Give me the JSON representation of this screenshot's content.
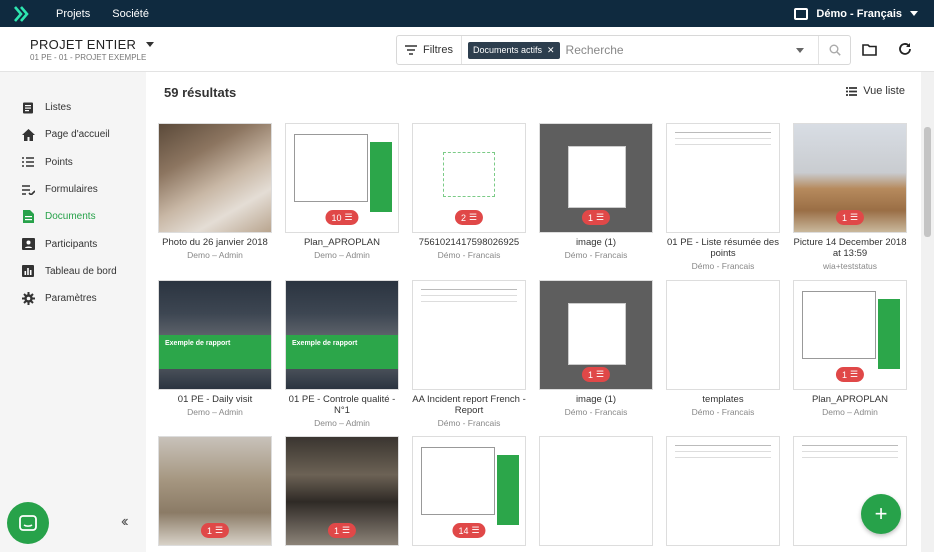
{
  "topbar": {
    "nav": [
      "Projets",
      "Société"
    ],
    "user": "Démo - Français"
  },
  "project": {
    "title": "PROJET ENTIER",
    "subtitle": "01 PE - 01 - PROJET EXEMPLE"
  },
  "filter": {
    "label": "Filtres",
    "chip": "Documents actifs",
    "search_placeholder": "Recherche"
  },
  "sidebar": {
    "items": [
      {
        "label": "Listes",
        "icon": "clipboard-icon"
      },
      {
        "label": "Page d'accueil",
        "icon": "home-icon"
      },
      {
        "label": "Points",
        "icon": "list-icon"
      },
      {
        "label": "Formulaires",
        "icon": "checklist-icon"
      },
      {
        "label": "Documents",
        "icon": "document-icon",
        "active": true
      },
      {
        "label": "Participants",
        "icon": "contact-card-icon"
      },
      {
        "label": "Tableau de bord",
        "icon": "bar-chart-icon"
      },
      {
        "label": "Paramètres",
        "icon": "gear-icon"
      }
    ]
  },
  "main": {
    "results": "59 résultats",
    "view_label": "Vue liste"
  },
  "cards": [
    {
      "name": "Photo du 26 janvier 2018",
      "author": "Demo – Admin",
      "badge": "",
      "thumb": "t-photo1"
    },
    {
      "name": "Plan_APROPLAN",
      "author": "Demo – Admin",
      "badge": "10",
      "thumb": "plan"
    },
    {
      "name": "7561021417598026925",
      "author": "Démo - Francais",
      "badge": "2",
      "thumb": "green-drawing"
    },
    {
      "name": "image (1)",
      "author": "Démo - Francais",
      "badge": "1",
      "thumb": "t-screen"
    },
    {
      "name": "01 PE - Liste résumée des points",
      "author": "Démo - Francais",
      "badge": "",
      "thumb": "doc"
    },
    {
      "name": "Picture 14 December 2018 at 13:59",
      "author": "wia+teststatus",
      "badge": "1",
      "thumb": "t-photo2"
    },
    {
      "name": "01 PE - Daily visit",
      "author": "Demo – Admin",
      "badge": "",
      "thumb": "report",
      "cover": "Exemple de rapport"
    },
    {
      "name": "01 PE - Controle qualité - N°1",
      "author": "Demo – Admin",
      "badge": "",
      "thumb": "report",
      "cover": "Exemple de rapport"
    },
    {
      "name": "AA Incident report French - Report",
      "author": "Démo - Francais",
      "badge": "",
      "thumb": "doc"
    },
    {
      "name": "image (1)",
      "author": "Démo - Francais",
      "badge": "1",
      "thumb": "t-screen"
    },
    {
      "name": "templates",
      "author": "Démo - Francais",
      "badge": "",
      "thumb": "blank"
    },
    {
      "name": "Plan_APROPLAN",
      "author": "Demo – Admin",
      "badge": "1",
      "thumb": "plan"
    },
    {
      "name": "",
      "author": "",
      "badge": "1",
      "thumb": "t-photo3"
    },
    {
      "name": "",
      "author": "",
      "badge": "1",
      "thumb": "t-photo4"
    },
    {
      "name": "",
      "author": "",
      "badge": "14",
      "thumb": "plan"
    },
    {
      "name": "",
      "author": "",
      "badge": "",
      "thumb": "blank"
    },
    {
      "name": "",
      "author": "",
      "badge": "",
      "thumb": "doc"
    },
    {
      "name": "",
      "author": "",
      "badge": "",
      "thumb": "doc"
    }
  ],
  "colors": {
    "topbar": "#0f2a3f",
    "accent": "#27a24a",
    "badge": "#e04848"
  }
}
